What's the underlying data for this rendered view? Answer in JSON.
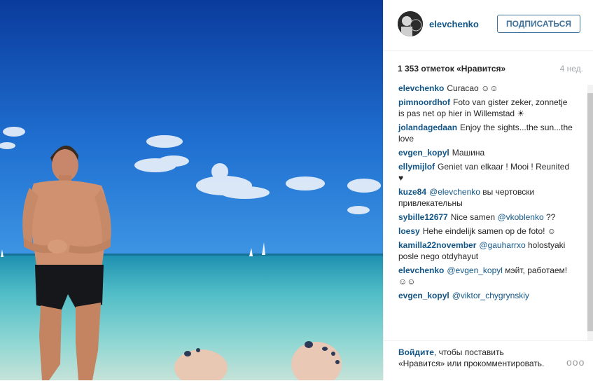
{
  "post": {
    "username": "elevchenko",
    "follow_label": "ПОДПИСАТЬСЯ",
    "likes": "1 353 отметок «Нравится»",
    "age": "4 нед.",
    "avatar_text": "LEV"
  },
  "comments": [
    {
      "user": "elevchenko",
      "text": "Curacao ☺☺"
    },
    {
      "user": "pimnoordhof",
      "text": "Foto van gister zeker, zonnetje is pas net op hier in Willemstad ☀"
    },
    {
      "user": "jolandagedaan",
      "text": "Enjoy the sights...the sun...the love"
    },
    {
      "user": "evgen_kopyl",
      "text": "Машина"
    },
    {
      "user": "ellymijlof",
      "text": "Geniet van elkaar ! Mooi ! Reunited ♥"
    },
    {
      "user": "kuze84",
      "mention": "@elevchenko",
      "text": "вы чертовски привлекательны"
    },
    {
      "user": "sybille12677",
      "text": "Nice samen",
      "mention_after": "@vkoblenko",
      "text_after": "??"
    },
    {
      "user": "loesy",
      "text": "Hehe eindelijk samen op de foto! ☺"
    },
    {
      "user": "kamilla22november",
      "mention": "@gauharrxo",
      "text": "holostyaki posle nego otdyhayut"
    },
    {
      "user": "elevchenko",
      "mention": "@evgen_kopyl",
      "text": "мэйт, работаем! ☺☺"
    },
    {
      "user": "evgen_kopyl",
      "mention": "@viktor_chygrynskiy",
      "text": ""
    }
  ],
  "footer": {
    "login_link": "Войдите",
    "text": ", чтобы поставить «Нравится» или прокомментировать.",
    "more": "ooo"
  },
  "colors": {
    "link": "#125688",
    "button": "#3f729b",
    "sky_top": "#0c3fa0",
    "sea": "#5fc3c9"
  }
}
